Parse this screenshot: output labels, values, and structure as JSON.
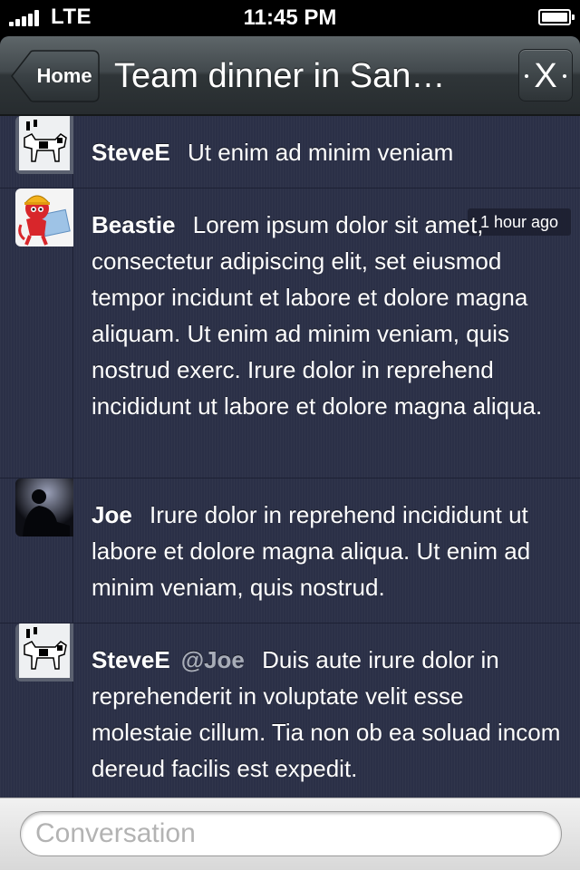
{
  "status_bar": {
    "carrier": "LTE",
    "time": "11:45 PM"
  },
  "nav": {
    "back_label": "Home",
    "title": "Team dinner in San…",
    "close_label": "X"
  },
  "messages": [
    {
      "author": "SteveE",
      "mention": "",
      "text": "Ut enim ad minim veniam",
      "timestamp": "",
      "avatar": "dogcow-avatar"
    },
    {
      "author": "Beastie",
      "mention": "",
      "text": "Lorem ipsum dolor sit amet, consectetur adipiscing elit, set eiusmod tempor incidunt et labore et dolore magna aliquam. Ut enim ad minim veniam, quis nostrud exerc. Irure dolor in reprehend incididunt ut labore et dolore magna aliqua.",
      "timestamp": "1 hour ago",
      "avatar": "beastie-avatar"
    },
    {
      "author": "Joe",
      "mention": "",
      "text": "Irure dolor in reprehend incididunt ut labore et dolore magna aliqua. Ut enim ad minim veniam, quis nostrud.",
      "timestamp": "",
      "avatar": "silhouette-avatar"
    },
    {
      "author": "SteveE",
      "mention": "@Joe",
      "text": "Duis aute irure dolor in reprehenderit in voluptate velit esse molestaie cillum. Tia non ob ea soluad incom dereud facilis est expedit.",
      "timestamp": "",
      "avatar": "dogcow-avatar"
    }
  ],
  "composer": {
    "placeholder": "Conversation"
  },
  "colors": {
    "list_background": "#2b3047",
    "navbar": "#3a4145",
    "composer_background": "#e4e4e4"
  }
}
